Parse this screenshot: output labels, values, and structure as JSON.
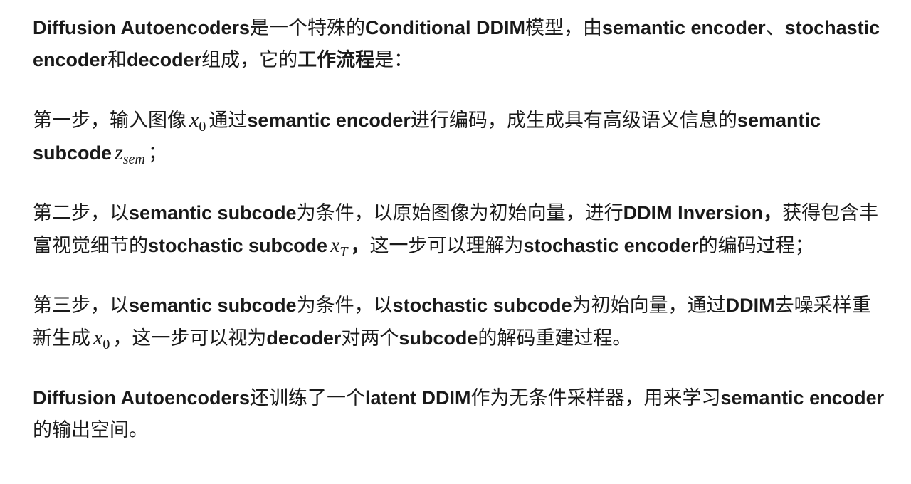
{
  "intro": {
    "term_diffae": "Diffusion Autoencoders",
    "t1": "是一个特殊的",
    "term_cond_ddim": "Conditional DDIM",
    "t2": "模型，由",
    "term_sem_enc": "semantic encoder",
    "t3": "、",
    "term_sto_enc": "stochastic encoder",
    "t4": "和",
    "term_decoder": "decoder",
    "t5": "组成，它的",
    "term_workflow": "工作流程",
    "t6": "是："
  },
  "step1": {
    "t1": "第一步，输入图像",
    "math_var": "x",
    "math_sub": "0",
    "t2": "通过",
    "term_sem_enc": "semantic encoder",
    "t3": "进行编码，成生成具有高级语义信息的",
    "term_sem_subcode": "semantic subcode",
    "math2_var": "z",
    "math2_sub": "sem",
    "t4": "；"
  },
  "step2": {
    "t1": "第二步，以",
    "term_sem_subcode": "semantic subcode",
    "t2": "为条件，以原始图像为初始向量，进行",
    "term_ddim_inv": "DDIM Inversion，",
    "t3": "获得包含丰富视觉细节的",
    "term_sto_subcode": "stochastic subcode",
    "math_var": "x",
    "math_sub": "T",
    "term_comma": "，",
    "t4": "这一步可以理解为",
    "term_sto_enc": "stochastic encoder",
    "t5": "的编码过程；"
  },
  "step3": {
    "t1": "第三步，以",
    "term_sem_subcode": "semantic subcode",
    "t2": "为条件，以",
    "term_sto_subcode": "stochastic subcode",
    "t3": "为初始向量，通过",
    "term_ddim": "DDIM",
    "t4": "去噪采样重新生成",
    "math_var": "x",
    "math_sub": "0",
    "t5": "，这一步可以视为",
    "term_decoder": "decoder",
    "t6": "对两个",
    "term_subcode": "subcode",
    "t7": "的解码重建过程。"
  },
  "outro": {
    "term_diffae": "Diffusion Autoencoders",
    "t1": "还训练了一个",
    "term_latent_ddim": "latent DDIM",
    "t2": "作为无条件采样器，用来学习",
    "term_sem_enc": "semantic encoder",
    "t3": "的输出空间。"
  }
}
